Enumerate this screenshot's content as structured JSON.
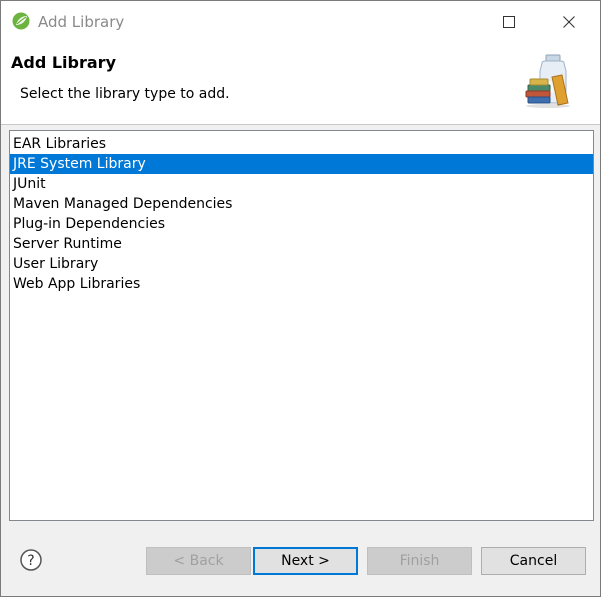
{
  "window": {
    "title": "Add Library"
  },
  "banner": {
    "title": "Add Library",
    "description": "Select the library type to add.",
    "image_icon": "library-books-jar-icon"
  },
  "library_types": [
    {
      "label": "EAR Libraries",
      "selected": false
    },
    {
      "label": "JRE System Library",
      "selected": true
    },
    {
      "label": "JUnit",
      "selected": false
    },
    {
      "label": "Maven Managed Dependencies",
      "selected": false
    },
    {
      "label": "Plug-in Dependencies",
      "selected": false
    },
    {
      "label": "Server Runtime",
      "selected": false
    },
    {
      "label": "User Library",
      "selected": false
    },
    {
      "label": "Web App Libraries",
      "selected": false
    }
  ],
  "buttons": {
    "back": "< Back",
    "next": "Next >",
    "finish": "Finish",
    "cancel": "Cancel",
    "help": "?"
  },
  "colors": {
    "selection": "#0078d7",
    "selection_text": "#ffffff",
    "title_text": "#8a8a8a"
  }
}
